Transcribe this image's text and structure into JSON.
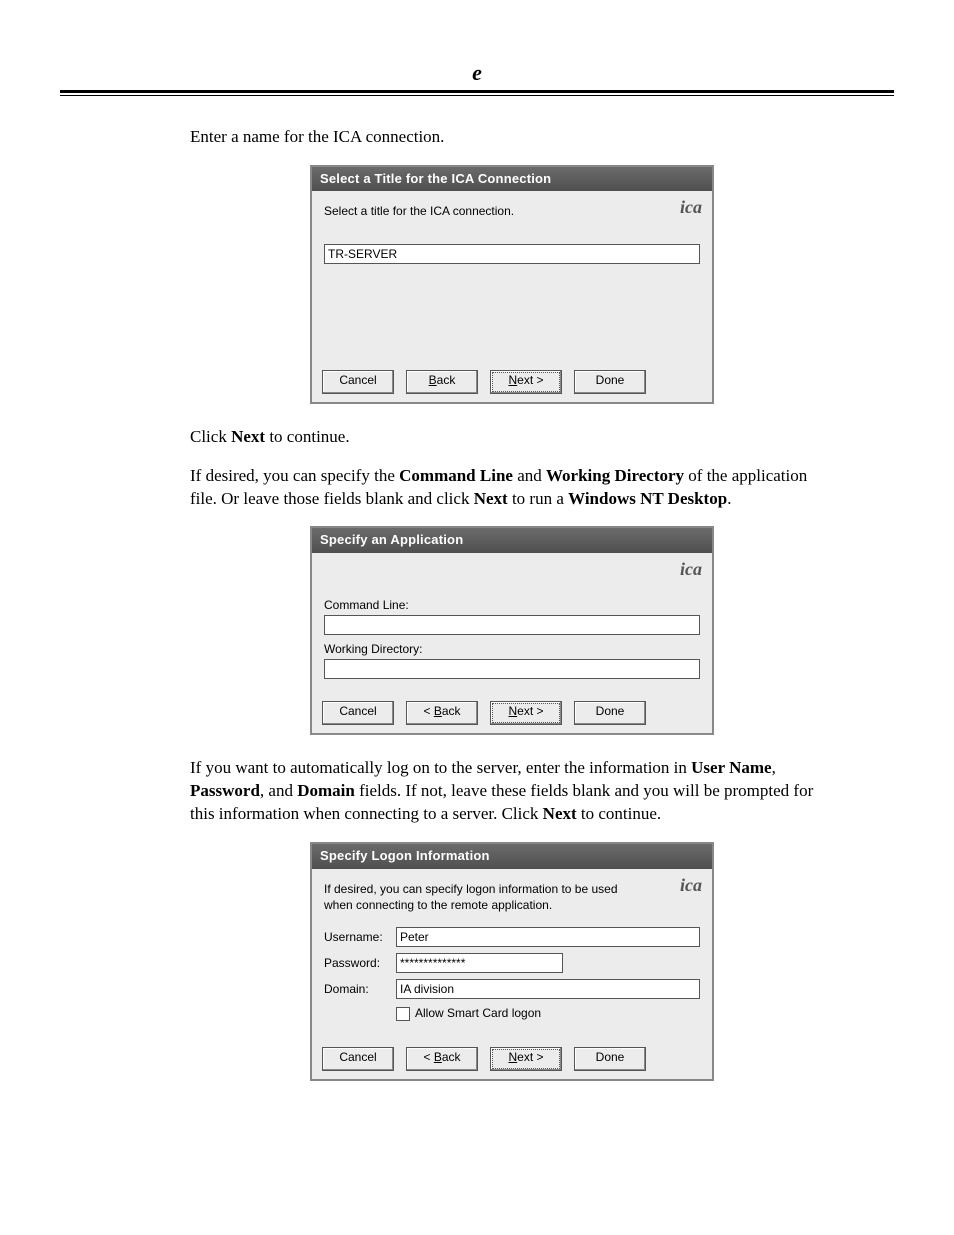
{
  "header": {
    "e": "e"
  },
  "intro1": "Enter a name for the ICA connection.",
  "dialog1": {
    "title": "Select a Title for the ICA Connection",
    "instruction": "Select a title for the ICA connection.",
    "logo": "ica",
    "value": "TR-SERVER",
    "buttons": {
      "cancel": "Cancel",
      "back": "< Back",
      "next": "Next >",
      "done": "Done"
    }
  },
  "para_click_next": {
    "pre": "Click ",
    "next": "Next",
    "post": " to continue."
  },
  "para_specify_app": {
    "pre": "If desired, you can specify the ",
    "cl": "Command Line",
    "mid1": " and ",
    "wd": "Working Directory",
    "mid2": " of the application file. Or leave those fields blank and click ",
    "next": "Next",
    "mid3": " to run a ",
    "wnt": "Windows NT Desktop",
    "post": "."
  },
  "dialog2": {
    "title": "Specify an Application",
    "logo": "ica",
    "cmd_label": "Command Line:",
    "wd_label": "Working Directory:",
    "cmd_value": "",
    "wd_value": "",
    "buttons": {
      "cancel": "Cancel",
      "back": "< Back",
      "next": "Next >",
      "done": "Done"
    }
  },
  "para_logon": {
    "pre": "If you want to automatically log on to the server, enter the information in ",
    "un": "User Name",
    "c1": ", ",
    "pw": "Password",
    "c2": ", and ",
    "dm": "Domain",
    "mid": " fields. If not, leave these fields blank and you will be prompted for this information when connecting to a server. Click ",
    "next": "Next",
    "post": " to continue."
  },
  "dialog3": {
    "title": "Specify Logon Information",
    "instruction": "If desired, you can specify logon information to be used when connecting to the remote application.",
    "logo": "ica",
    "username_label": "Username:",
    "username_value": "Peter",
    "password_label": "Password:",
    "password_value": "**************",
    "domain_label": "Domain:",
    "domain_value": "IA division",
    "smartcard_label": "Allow Smart Card logon",
    "buttons": {
      "cancel": "Cancel",
      "back": "< Back",
      "next": "Next >",
      "done": "Done"
    }
  }
}
